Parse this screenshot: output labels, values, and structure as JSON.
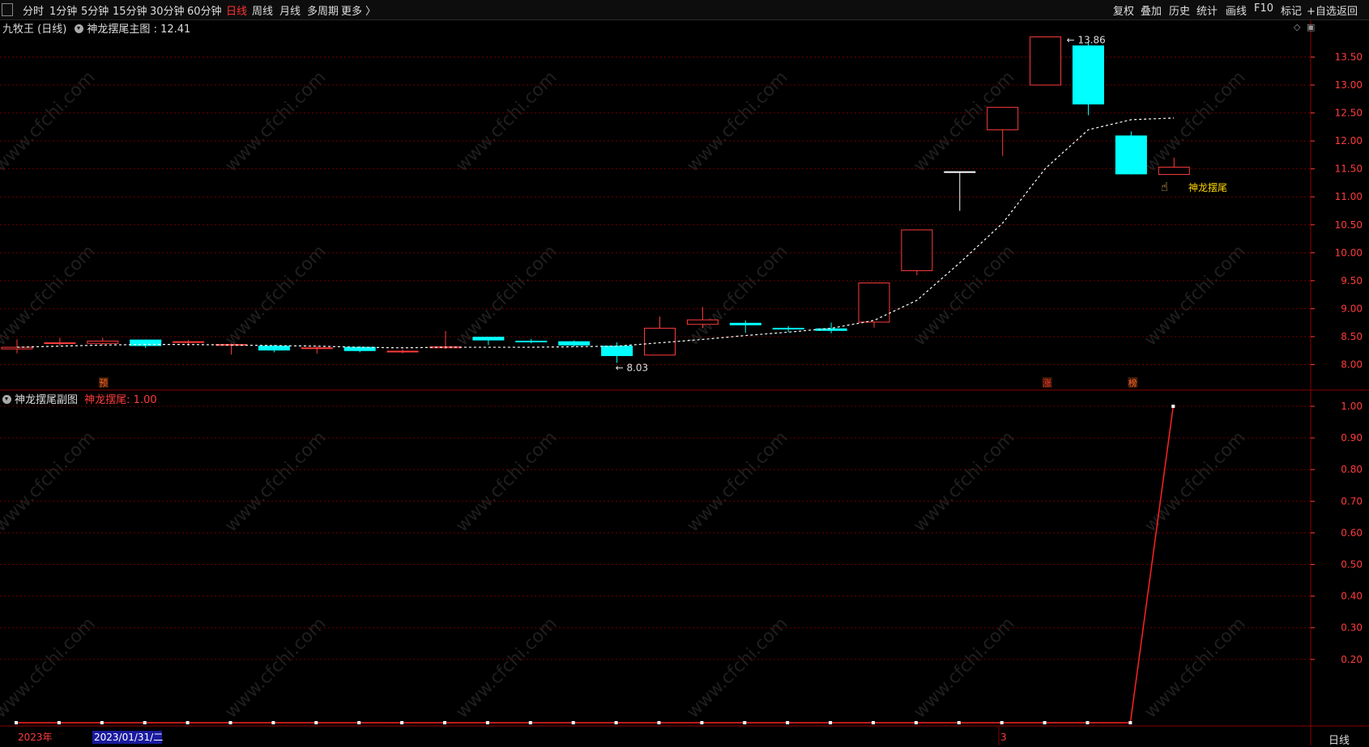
{
  "toolbar": {
    "left": [
      "分时",
      "1分钟",
      "5分钟",
      "15分钟",
      "30分钟",
      "60分钟",
      "日线",
      "周线",
      "月线",
      "多周期",
      "更多 〉"
    ],
    "active": "日线",
    "right": [
      "复权",
      "叠加",
      "历史",
      "统计",
      "画线",
      "F10",
      "+自选",
      "返回"
    ],
    "mark_label": "标记"
  },
  "main": {
    "stock": "九牧王 (日线)",
    "indicator": "神龙摆尾主图",
    "value": ": 12.41",
    "y_ticks": [
      "13.50",
      "13.00",
      "12.50",
      "12.00",
      "11.50",
      "11.00",
      "10.50",
      "10.00",
      "9.50",
      "9.00",
      "8.50",
      "8.00"
    ],
    "high_label": "13.86",
    "low_label": "8.03",
    "signal_label": "神龙摆尾",
    "markers": [
      "预",
      "涨",
      "榜"
    ]
  },
  "sub": {
    "title": "神龙摆尾副图",
    "value_label": "神龙摆尾: 1.00",
    "y_ticks": [
      "1.00",
      "0.90",
      "0.80",
      "0.70",
      "0.60",
      "0.50",
      "0.40",
      "0.30",
      "0.20"
    ]
  },
  "xaxis": {
    "year": "2023年",
    "cursor_date": "2023/01/31/二",
    "month": "3"
  },
  "period_label": "日线",
  "watermark": "www.cfchi.com",
  "colors": {
    "up": "#ff3b3b",
    "down": "#00ffff",
    "grid": "#6b0000",
    "ma": "#ffffff",
    "signal": "#ffd700"
  },
  "chart_data": [
    {
      "type": "candlestick",
      "title": "神龙摆尾主图",
      "ylim": [
        7.9,
        13.9
      ],
      "series": [
        {
          "name": "candles",
          "ohlc": [
            [
              8.28,
              8.31,
              8.45,
              8.2
            ],
            [
              8.38,
              8.39,
              8.48,
              8.34
            ],
            [
              8.38,
              8.42,
              8.48,
              8.35
            ],
            [
              8.44,
              8.34,
              8.45,
              8.3
            ],
            [
              8.4,
              8.41,
              8.44,
              8.33
            ],
            [
              8.36,
              8.36,
              8.38,
              8.18
            ],
            [
              8.33,
              8.26,
              8.35,
              8.22
            ],
            [
              8.3,
              8.3,
              8.33,
              8.2
            ],
            [
              8.31,
              8.25,
              8.33,
              8.22
            ],
            [
              8.23,
              8.24,
              8.27,
              8.2
            ],
            [
              8.3,
              8.32,
              8.6,
              8.28
            ],
            [
              8.49,
              8.44,
              8.49,
              8.35
            ],
            [
              8.42,
              8.41,
              8.46,
              8.38
            ],
            [
              8.41,
              8.35,
              8.43,
              8.32
            ],
            [
              8.33,
              8.16,
              8.4,
              8.03
            ],
            [
              8.17,
              8.65,
              8.86,
              8.17
            ],
            [
              8.72,
              8.8,
              9.03,
              8.65
            ],
            [
              8.74,
              8.71,
              8.79,
              8.57
            ],
            [
              8.65,
              8.64,
              8.69,
              8.58
            ],
            [
              8.64,
              8.61,
              8.75,
              8.56
            ],
            [
              8.76,
              9.46,
              9.46,
              8.66
            ],
            [
              9.68,
              10.41,
              10.41,
              9.6
            ],
            [
              11.45,
              11.45,
              11.45,
              10.75
            ],
            [
              12.2,
              12.6,
              12.6,
              11.73
            ],
            [
              13.0,
              13.86,
              13.86,
              13.0
            ],
            [
              13.7,
              12.66,
              13.78,
              12.46
            ],
            [
              12.09,
              11.41,
              12.17,
              11.4
            ],
            [
              11.4,
              11.53,
              11.7,
              11.4
            ]
          ]
        },
        {
          "name": "ma",
          "values": [
            8.31,
            8.33,
            8.35,
            8.36,
            8.36,
            8.35,
            8.34,
            8.33,
            8.31,
            8.3,
            8.31,
            8.31,
            8.31,
            8.32,
            8.33,
            8.39,
            8.45,
            8.52,
            8.58,
            8.65,
            8.79,
            9.15,
            9.82,
            10.53,
            11.51,
            12.2,
            12.38,
            12.41
          ]
        }
      ]
    },
    {
      "type": "line",
      "title": "神龙摆尾副图",
      "ylim": [
        0,
        1.08
      ],
      "series": [
        {
          "name": "神龙摆尾",
          "values": [
            0,
            0,
            0,
            0,
            0,
            0,
            0,
            0,
            0,
            0,
            0,
            0,
            0,
            0,
            0,
            0,
            0,
            0,
            0,
            0,
            0,
            0,
            0,
            0,
            0,
            0,
            0,
            1
          ]
        }
      ]
    }
  ]
}
